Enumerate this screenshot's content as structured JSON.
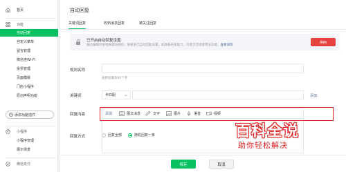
{
  "sidebar": {
    "home": "首页",
    "section_features": "功能",
    "items": [
      "自动回复",
      "自定义菜单",
      "留言管理",
      "微信连Wi-Fi",
      "投票管理",
      "页面模版",
      "门店小程序",
      "原创声明功能"
    ],
    "add_plugin": "添加功能插件",
    "section_miniprogram": "小程序",
    "mp_items": [
      "小程序管理",
      "展示场景"
    ],
    "section_pay": "微信支付"
  },
  "page": {
    "title": "自动回复",
    "tabs": [
      "关键词回复",
      "收到消息回复",
      "被关注回复"
    ]
  },
  "notice": {
    "title": "已开启自动回复设置",
    "desc": "通过编辑内容或关键词规则，快速进行自动回复设置。如具备开发能力，可更灵活地使用该功能。",
    "link": "查看详情",
    "button": "停用"
  },
  "form": {
    "rule_name_label": "规则名称",
    "rule_name_hint": "规则名最多60个字",
    "keyword_label": "关键词",
    "match_mode": "半匹配",
    "add_link": "添加",
    "reply_content_label": "回复内容",
    "reply_toolbar": {
      "add": "添加",
      "items": [
        "图文消息",
        "文字",
        "图片",
        "语音",
        "视频"
      ]
    },
    "reply_mode_label": "回复方式",
    "reply_options": [
      "回复全部",
      "随机回复一条"
    ],
    "reply_selected": "随机回复一条"
  },
  "footer": {
    "save": "保存",
    "cancel": "取消"
  },
  "watermark": {
    "title": "百科全说",
    "subtitle": "助你轻松解决"
  },
  "colors": {
    "accent": "#07c160",
    "danger": "#e64340",
    "link": "#576b95",
    "highlight": "#e02020"
  }
}
